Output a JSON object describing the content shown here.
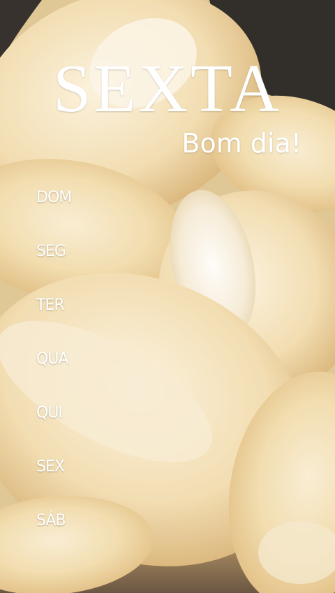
{
  "header": {
    "title": "SEXTA",
    "greeting": "Bom dia!"
  },
  "days": [
    {
      "label": "DOM"
    },
    {
      "label": "SEG"
    },
    {
      "label": "TER"
    },
    {
      "label": "QUA"
    },
    {
      "label": "QUI"
    },
    {
      "label": "SEX"
    },
    {
      "label": "SÁB"
    }
  ],
  "colors": {
    "text": "#ffffff",
    "bread_crust": "#e9c98a",
    "bread_crumb": "#f6ecd6",
    "background_dark": "#000000"
  }
}
